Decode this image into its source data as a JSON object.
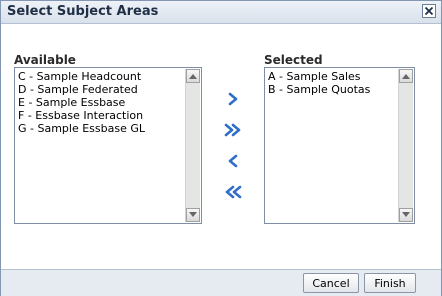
{
  "dialog": {
    "title": "Select Subject Areas",
    "close_icon": "close-x-icon"
  },
  "available": {
    "label": "Available",
    "items": [
      "C - Sample Headcount",
      "D - Sample Federated",
      "E - Sample Essbase",
      "F - Essbase Interaction",
      "G - Sample Essbase GL"
    ]
  },
  "selected": {
    "label": "Selected",
    "items": [
      "A - Sample Sales",
      "B - Sample Quotas"
    ]
  },
  "move_buttons": {
    "move_right_icon": "chevron-right-icon",
    "move_all_right_icon": "double-chevron-right-icon",
    "move_left_icon": "chevron-left-icon",
    "move_all_left_icon": "double-chevron-left-icon"
  },
  "footer": {
    "cancel_label": "Cancel",
    "finish_label": "Finish"
  },
  "colors": {
    "accent_blue": "#2f6fc9",
    "titlebar": "#dde4ee",
    "footer": "#e6ebf2"
  }
}
